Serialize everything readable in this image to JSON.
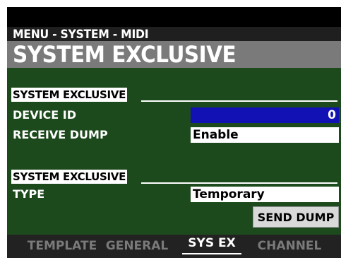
{
  "header": {
    "breadcrumb": "MENU - SYSTEM - MIDI",
    "title": "SYSTEM EXCLUSIVE"
  },
  "sections": [
    {
      "heading": "SYSTEM EXCLUSIVE",
      "rows": [
        {
          "label": "DEVICE ID",
          "value": "0"
        },
        {
          "label": "RECEIVE DUMP",
          "value": "Enable"
        }
      ]
    },
    {
      "heading": "SYSTEM EXCLUSIVE",
      "rows": [
        {
          "label": "TYPE",
          "value": "Temporary"
        }
      ]
    }
  ],
  "send_dump_label": "SEND DUMP",
  "tabs": [
    {
      "label": "TEMPLATE",
      "selected": false
    },
    {
      "label": "GENERAL",
      "selected": false
    },
    {
      "label": "SYS EX",
      "selected": true
    },
    {
      "label": "CHANNEL",
      "selected": false
    }
  ],
  "colors": {
    "panel": "#1d4a1d",
    "selected_field": "#1111b4",
    "header_band": "#7a7a7a"
  }
}
